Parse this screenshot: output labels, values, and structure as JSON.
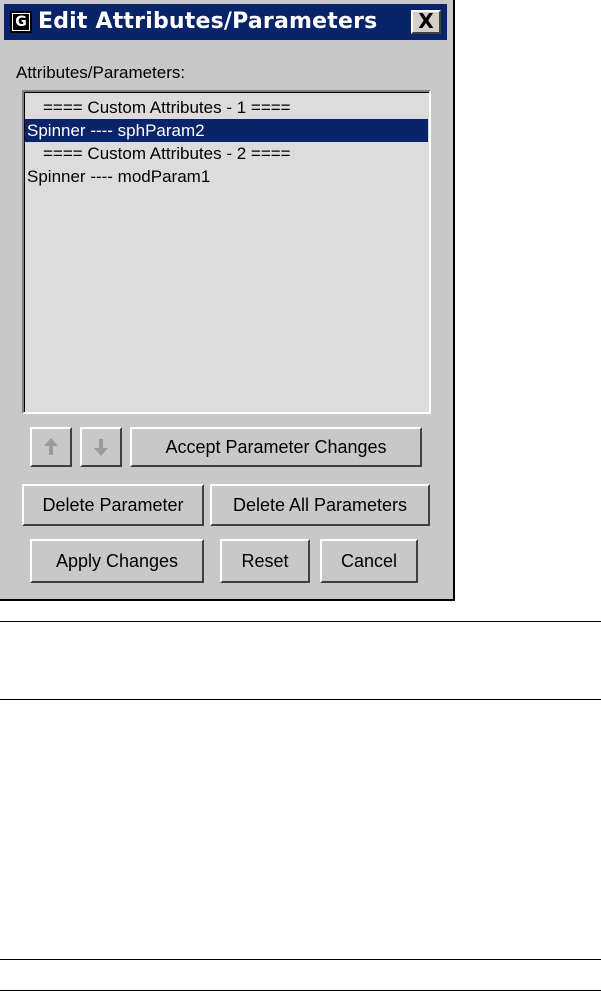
{
  "window": {
    "title": "Edit Attributes/Parameters",
    "close_label": "X"
  },
  "list": {
    "label": "Attributes/Parameters:",
    "items": [
      {
        "text": "==== Custom Attributes - 1 ===="
      },
      {
        "text": "Spinner ---- sphParam2"
      },
      {
        "text": "==== Custom Attributes - 2 ===="
      },
      {
        "text": "Spinner ---- modParam1"
      }
    ],
    "selected_index": 1
  },
  "buttons": {
    "move_up_icon": "arrow-up-icon",
    "move_down_icon": "arrow-down-icon",
    "accept": "Accept Parameter Changes",
    "delete_param": "Delete Parameter",
    "delete_all": "Delete All Parameters",
    "apply": "Apply Changes",
    "reset": "Reset",
    "cancel": "Cancel"
  },
  "colors": {
    "titlebar": "#0a246a",
    "dialog_bg": "#c8c8c8",
    "selection": "#0a246a"
  }
}
